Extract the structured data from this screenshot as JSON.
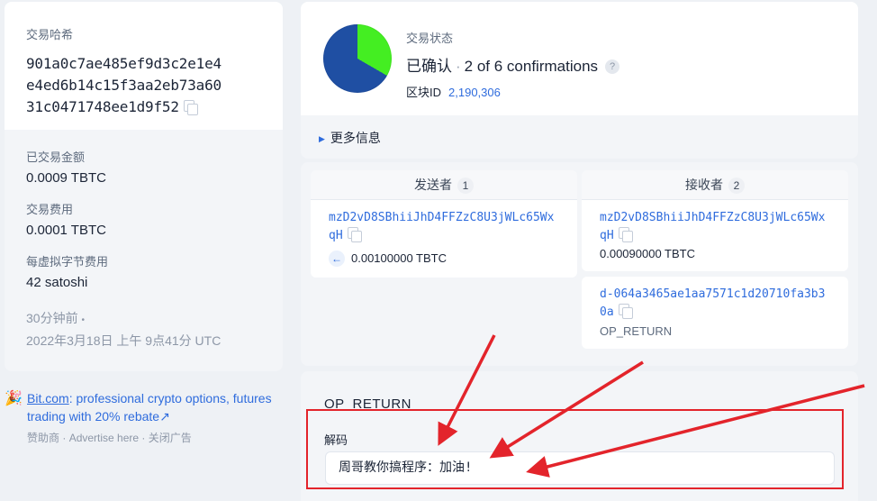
{
  "tx_hash": {
    "label": "交易哈希",
    "lines": [
      "901a0c7ae485ef9d3c2e1e4",
      "e4ed6b14c15f3aa2eb73a60",
      "31c0471748ee1d9f52"
    ]
  },
  "summary": {
    "amount_label": "已交易金额",
    "amount_value": "0.0009 TBTC",
    "fee_label": "交易费用",
    "fee_value": "0.0001 TBTC",
    "vbyte_fee_label": "每虚拟字节费用",
    "vbyte_fee_value": "42 satoshi",
    "time_relative": "30分钟前",
    "time_sep": "•",
    "time_absolute": "2022年3月18日 上午 9点41分 UTC"
  },
  "sponsor": {
    "emoji": "🎉",
    "brand": "Bit.com",
    "text": ": professional crypto options, futures trading with 20% rebate",
    "arrow": "↗",
    "sponsor_label": "赞助商",
    "advertise": "Advertise here",
    "close_ad": "关闭广告",
    "sep": "·"
  },
  "status": {
    "label": "交易状态",
    "confirmed": "已确认",
    "sep": "·",
    "confirmations": "2 of 6 confirmations",
    "help": "?",
    "block_label": "区块ID",
    "block_id": "2,190,306",
    "more_info": "更多信息",
    "pie_confirmed_fraction": 0.333,
    "pie_colors": {
      "confirmed": "#44ee22",
      "pending": "#1f4fa3"
    }
  },
  "senders": {
    "title": "发送者",
    "count": "1",
    "address": "mzD2vD8SBhiiJhD4FFZzC8U3jWLc65WxqH",
    "amount": "0.00100000 TBTC"
  },
  "receivers": {
    "title": "接收者",
    "count": "2",
    "items": [
      {
        "address": "mzD2vD8SBhiiJhD4FFZzC8U3jWLc65WxqH",
        "amount": "0.00090000 TBTC"
      },
      {
        "address": "d-064a3465ae1aa7571c1d20710fa3b30a",
        "type": "OP_RETURN"
      }
    ]
  },
  "op_return": {
    "title": "OP_RETURN",
    "decode_label": "解码",
    "decoded": "周哥教你搞程序：加油!"
  },
  "annotation": {
    "color": "#e3242b"
  }
}
